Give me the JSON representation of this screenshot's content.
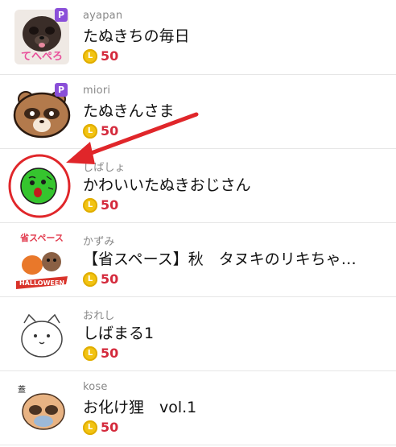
{
  "items": [
    {
      "author": "ayapan",
      "title": "たぬきちの毎日",
      "price": "50",
      "coin_letter": "L",
      "premium": "P",
      "thumb_text": "てへぺろ"
    },
    {
      "author": "miori",
      "title": "たぬきんさま",
      "price": "50",
      "coin_letter": "L",
      "premium": "P"
    },
    {
      "author": "しばしょ",
      "title": "かわいいたぬきおじさん",
      "price": "50",
      "coin_letter": "L"
    },
    {
      "author": "かずみ",
      "title": "【省スペース】秋　タヌキのリキちゃ…",
      "price": "50",
      "coin_letter": "L",
      "thumb_text": "省スペース",
      "thumb_text2": "HALLOWEEN"
    },
    {
      "author": "おれし",
      "title": "しばまる1",
      "price": "50",
      "coin_letter": "L"
    },
    {
      "author": "kose",
      "title": "お化け狸　vol.1",
      "price": "50",
      "coin_letter": "L",
      "thumb_text": "蓋"
    }
  ],
  "colors": {
    "accent_price": "#d42a3c",
    "coin": "#f2c311",
    "premium_badge": "#8a4fd8",
    "annotation": "#e0262a"
  }
}
